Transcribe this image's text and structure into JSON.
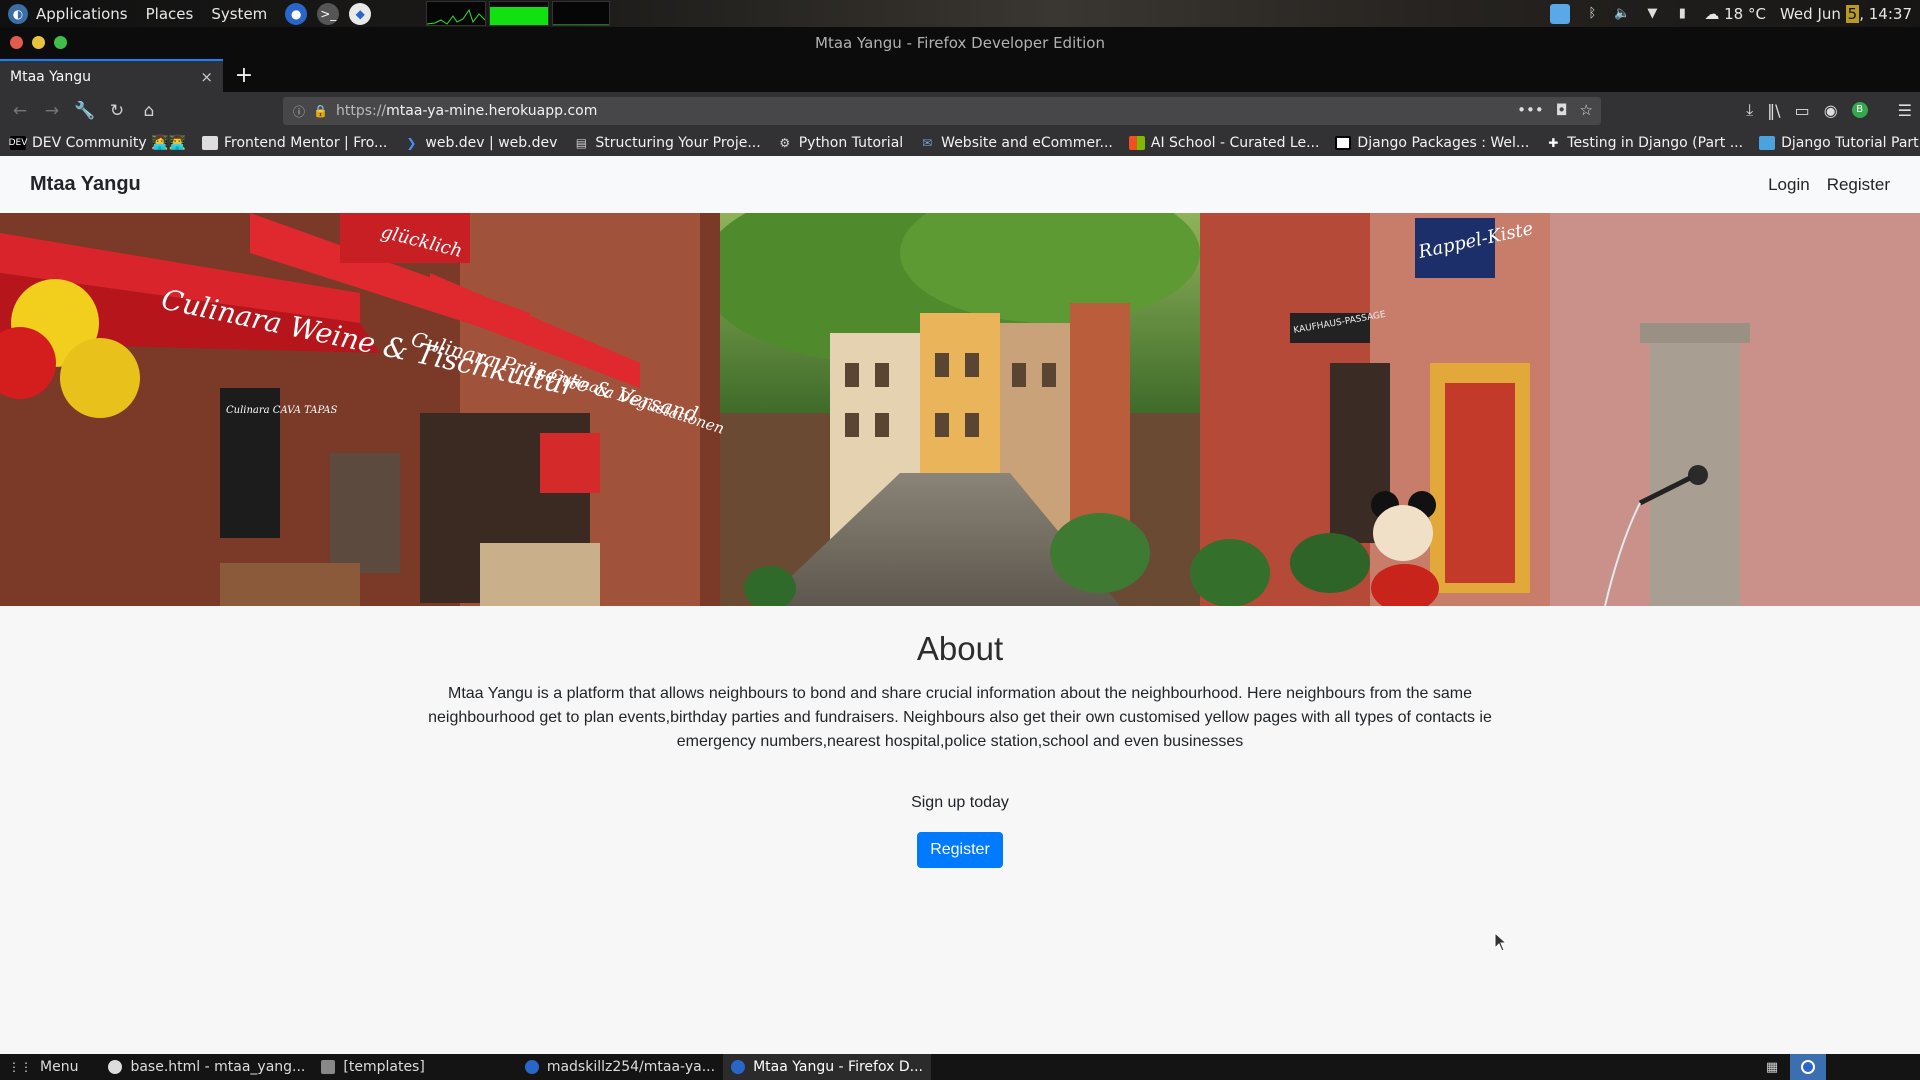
{
  "system_panel": {
    "menus": [
      "Applications",
      "Places",
      "System"
    ],
    "weather": "18 °C",
    "clock_date": "Wed Jun",
    "clock_day": "5",
    "clock_time": "14:37"
  },
  "window": {
    "title": "Mtaa Yangu - Firefox Developer Edition"
  },
  "tabs": [
    {
      "label": "Mtaa Yangu",
      "close": "×"
    }
  ],
  "new_tab": "+",
  "address_bar": {
    "url_scheme": "https://",
    "url_host": "mtaa-ya-mine.herokuapp.com"
  },
  "bookmarks": [
    {
      "label": "DEV Community 👩‍💻👨‍💻",
      "icon": "dev-icon"
    },
    {
      "label": "Frontend Mentor | Fro...",
      "icon": "frontend-mentor-icon"
    },
    {
      "label": "web.dev  |  web.dev",
      "icon": "webdev-icon"
    },
    {
      "label": "Structuring Your Proje...",
      "icon": "doc-icon"
    },
    {
      "label": "Python Tutorial",
      "icon": "python-icon"
    },
    {
      "label": "Website and eCommer...",
      "icon": "website-icon"
    },
    {
      "label": "AI School - Curated Le...",
      "icon": "microsoft-icon"
    },
    {
      "label": "Django Packages : Wel...",
      "icon": "django-packages-icon"
    },
    {
      "label": "Testing in Django (Part ...",
      "icon": "testing-icon"
    },
    {
      "label": "Django Tutorial Part 10...",
      "icon": "django-tutorial-icon"
    }
  ],
  "site": {
    "brand": "Mtaa Yangu",
    "nav_links": [
      "Login",
      "Register"
    ],
    "hero_signs": {
      "awning_1": "Culinara Weine & Tischkultur",
      "awning_2": "Culinara Präsente & Versand",
      "awning_3": "Culinara Degustationen",
      "top_sign": "glücklich",
      "right_sign": "Rappel-Kiste",
      "passage": "KAUFHAUS-PASSAGE",
      "board": "Culinara CAVA TAPAS"
    },
    "about_title": "About",
    "about_text": "Mtaa Yangu is a platform that allows neighbours to bond and share crucial information about the neighbourhood. Here neighbours from the same neighbourhood get to plan events,birthday parties and fundraisers. Neighbours also get their own customised yellow pages with all types of contacts ie emergency numbers,nearest hospital,police station,school and even businesses",
    "signup_text": "Sign up today",
    "register_button": "Register"
  },
  "taskbar": {
    "menu": "Menu",
    "items": [
      {
        "label": "base.html - mtaa_yang...",
        "active": false
      },
      {
        "label": "[templates]",
        "active": false
      },
      {
        "label": "madskillz254/mtaa-ya...",
        "active": false
      },
      {
        "label": "Mtaa Yangu - Firefox D...",
        "active": true
      }
    ]
  },
  "colors": {
    "accent": "#0a84ff",
    "primary_button": "#007bff",
    "nav_bg": "#f8f9fa",
    "toolbar": "#323234"
  }
}
